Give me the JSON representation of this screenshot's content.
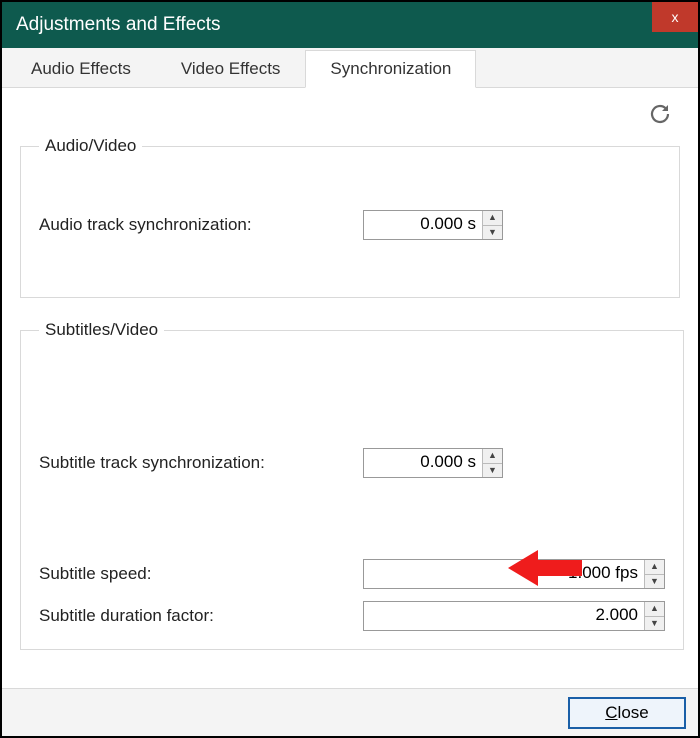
{
  "window": {
    "title": "Adjustments and Effects"
  },
  "tabs": {
    "audio_effects": "Audio Effects",
    "video_effects": "Video Effects",
    "synchronization": "Synchronization"
  },
  "groups": {
    "audio_video": {
      "legend": "Audio/Video",
      "audio_sync_label": "Audio track synchronization:",
      "audio_sync_value": "0.000 s"
    },
    "subtitles_video": {
      "legend": "Subtitles/Video",
      "subtitle_sync_label": "Subtitle track synchronization:",
      "subtitle_sync_value": "0.000 s",
      "subtitle_speed_label": "Subtitle speed:",
      "subtitle_speed_value": "1.000 fps",
      "subtitle_duration_label": "Subtitle duration factor:",
      "subtitle_duration_value": "2.000"
    }
  },
  "buttons": {
    "close_first": "C",
    "close_rest": "lose"
  },
  "icons": {
    "close_x": "x",
    "refresh": "refresh-icon",
    "spin_up": "▲",
    "spin_down": "▼"
  }
}
